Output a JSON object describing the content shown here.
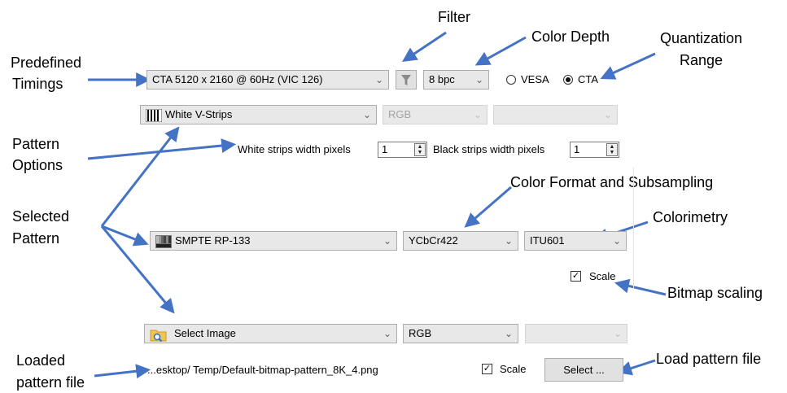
{
  "annotations": {
    "filter": "Filter",
    "color_depth": "Color Depth",
    "quantization_line1": "Quantization",
    "quantization_line2": "Range",
    "predefined_line1": "Predefined",
    "predefined_line2": "Timings",
    "pattern_options_line1": "Pattern",
    "pattern_options_line2": "Options",
    "color_format": "Color Format and Subsampling",
    "selected_line1": "Selected",
    "selected_line2": "Pattern",
    "colorimetry": "Colorimetry",
    "bitmap_scaling": "Bitmap scaling",
    "loaded_line1": "Loaded",
    "loaded_line2": "pattern file",
    "load_pattern_file": "Load pattern file"
  },
  "timing": {
    "selected": "CTA 5120 x 2160 @ 60Hz (VIC 126)",
    "bpc": "8 bpc",
    "vesa_label": "VESA",
    "cta_label": "CTA",
    "quantization_selected": "CTA"
  },
  "pattern1": {
    "selected": "White V-Strips",
    "color_format": "RGB",
    "colorimetry": "",
    "white_width_label": "White strips width pixels",
    "white_width_value": "1",
    "black_width_label": "Black strips width pixels",
    "black_width_value": "1"
  },
  "pattern2": {
    "selected": "SMPTE RP-133",
    "color_format": "YCbCr422",
    "colorimetry": "ITU601",
    "scale_label": "Scale",
    "scale_checked": true
  },
  "pattern3": {
    "selected": "Select Image",
    "color_format": "RGB",
    "colorimetry": "",
    "file_path": "...esktop/ Temp/Default-bitmap-pattern_8K_4.png",
    "scale_label": "Scale",
    "scale_checked": true,
    "select_button": "Select ..."
  },
  "colors": {
    "arrow": "#4472c4",
    "combo_bg": "#e8e8e8",
    "disabled_text": "#a3a3a3"
  }
}
